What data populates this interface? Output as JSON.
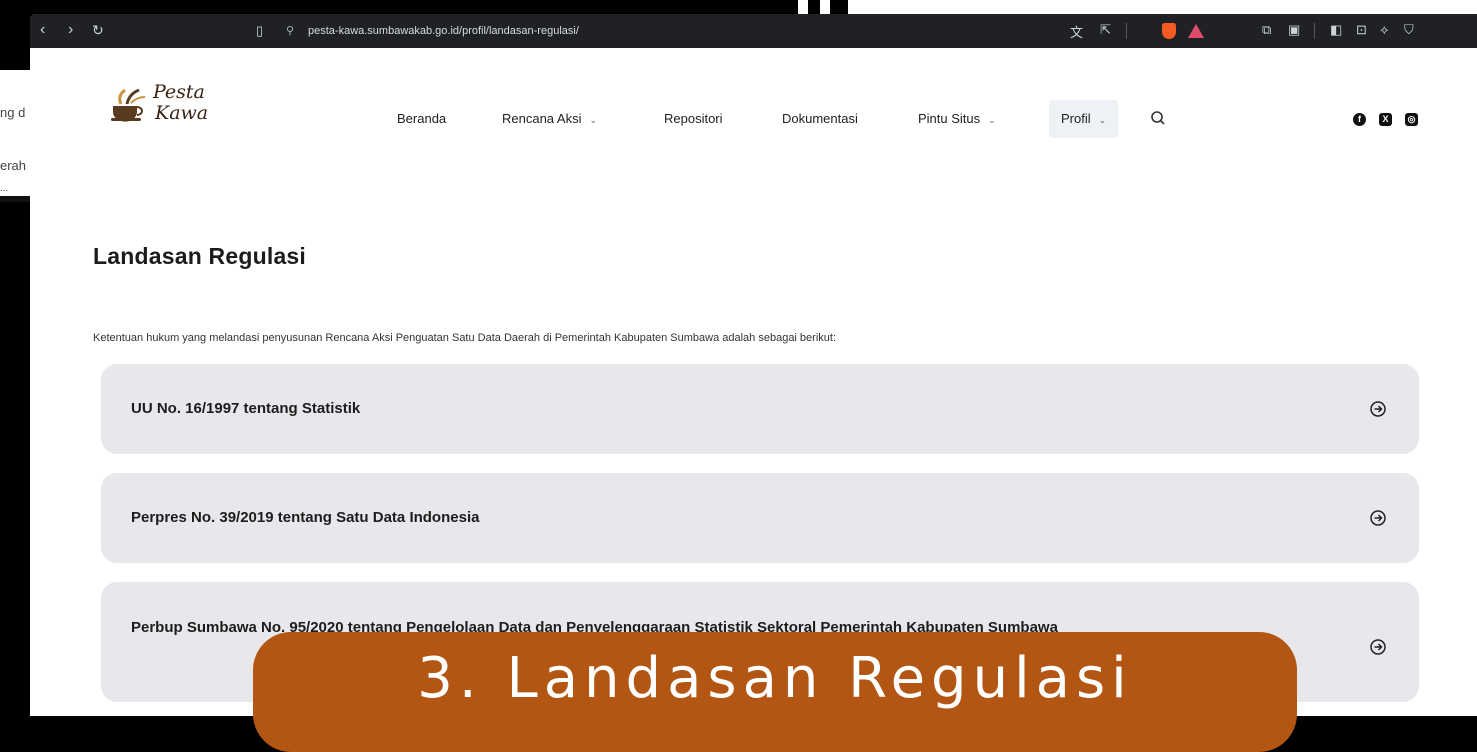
{
  "background": {
    "left_text": [
      "ng d",
      "erah",
      "..."
    ]
  },
  "browser": {
    "url": "pesta-kawa.sumbawakab.go.id/profil/landasan-regulasi/"
  },
  "site": {
    "logo": {
      "line1": "Pesta",
      "line2": "Kawa"
    },
    "nav": [
      {
        "label": "Beranda",
        "has_menu": false
      },
      {
        "label": "Rencana Aksi",
        "has_menu": true
      },
      {
        "label": "Repositori",
        "has_menu": false
      },
      {
        "label": "Dokumentasi",
        "has_menu": false
      },
      {
        "label": "Pintu Situs",
        "has_menu": true
      },
      {
        "label": "Profil",
        "has_menu": true,
        "active": true
      }
    ],
    "chevron": "⌄",
    "social": [
      "facebook-icon",
      "x-icon",
      "instagram-icon"
    ]
  },
  "content": {
    "title": "Landasan Regulasi",
    "intro": "Ketentuan hukum yang melandasi penyusunan Rencana Aksi Penguatan Satu Data Daerah di Pemerintah Kabupaten Sumbawa adalah sebagai berikut:",
    "items": [
      {
        "text": "UU No. 16/1997 tentang Statistik"
      },
      {
        "text": "Perpres No. 39/2019 tentang Satu Data Indonesia"
      },
      {
        "text": "Perbup Sumbawa No. 95/2020 tentang Pengelolaan Data dan Penyelenggaraan Statistik Sektoral Pemerintah Kabupaten Sumbawa"
      }
    ]
  },
  "overlay": {
    "banner": "3. Landasan Regulasi"
  },
  "colors": {
    "banner": "#b35613",
    "card": "#e7e7ec",
    "toolbar": "#1f2125"
  }
}
